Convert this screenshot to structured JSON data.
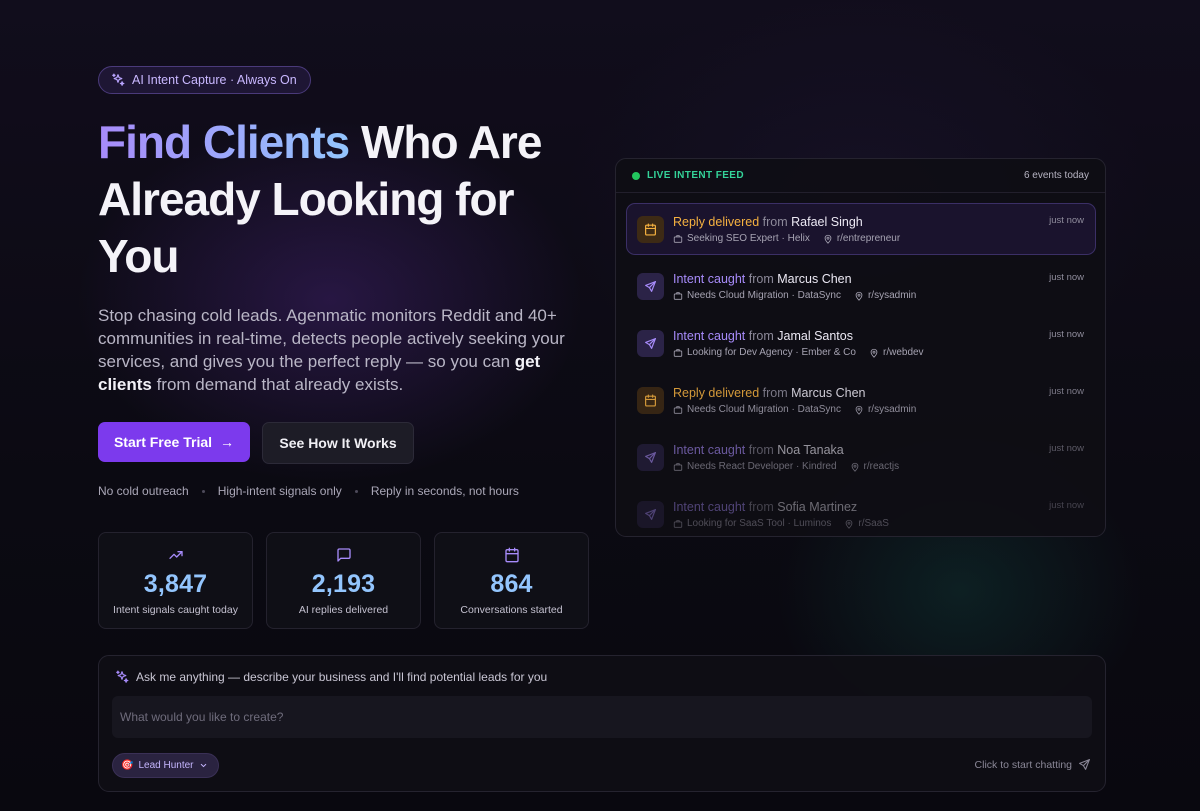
{
  "badge": {
    "label": "AI Intent Capture · Always On",
    "icon": "sparkles-icon"
  },
  "hero": {
    "title_highlight": "Find Clients",
    "title_rest": " Who Are Already Looking for You",
    "lead_before": "Stop chasing cold leads. Agenmatic monitors Reddit and 40+ communities in real-time, detects people actively seeking your services, and gives you the perfect reply — so you can ",
    "lead_bold": "get clients",
    "lead_after": " from demand that already exists."
  },
  "cta": {
    "primary_label": "Start Free Trial",
    "primary_arrow": "→",
    "secondary_label": "See How It Works"
  },
  "perks": [
    "No cold outreach",
    "High-intent signals only",
    "Reply in seconds, not hours"
  ],
  "stats": [
    {
      "icon": "trending-up-icon",
      "value": "3,847",
      "label": "Intent signals caught today"
    },
    {
      "icon": "message-square-icon",
      "value": "2,193",
      "label": "AI replies delivered"
    },
    {
      "icon": "calendar-icon",
      "value": "864",
      "label": "Conversations started"
    }
  ],
  "feed": {
    "title": "LIVE INTENT FEED",
    "count": "6 events today",
    "events": [
      {
        "kind": "Reply delivered",
        "from": "from",
        "name": "Rafael Singh",
        "need": "Seeking SEO Expert · Helix",
        "community": "r/entrepreneur",
        "time": "just now"
      },
      {
        "kind": "Intent caught",
        "from": "from",
        "name": "Marcus Chen",
        "need": "Needs Cloud Migration · DataSync",
        "community": "r/sysadmin",
        "time": "just now"
      },
      {
        "kind": "Intent caught",
        "from": "from",
        "name": "Jamal Santos",
        "need": "Looking for Dev Agency · Ember & Co",
        "community": "r/webdev",
        "time": "just now"
      },
      {
        "kind": "Reply delivered",
        "from": "from",
        "name": "Marcus Chen",
        "need": "Needs Cloud Migration · DataSync",
        "community": "r/sysadmin",
        "time": "just now"
      },
      {
        "kind": "Intent caught",
        "from": "from",
        "name": "Noa Tanaka",
        "need": "Needs React Developer · Kindred",
        "community": "r/reactjs",
        "time": "just now"
      },
      {
        "kind": "Intent caught",
        "from": "from",
        "name": "Sofia Martinez",
        "need": "Looking for SaaS Tool · Luminos",
        "community": "r/SaaS",
        "time": "just now"
      }
    ]
  },
  "chat": {
    "prompt": "Ask me anything — describe your business and I'll find potential leads for you",
    "placeholder": "What would you like to create?",
    "agent_label": "Lead Hunter",
    "agent_emoji": "🎯",
    "hint": "Click to start chatting"
  },
  "colors": {
    "accent": "#7c3aed",
    "stat_value": "#93c5fd",
    "reply": "#f5b140",
    "intent": "#a78bfa",
    "live": "#22c55e"
  }
}
